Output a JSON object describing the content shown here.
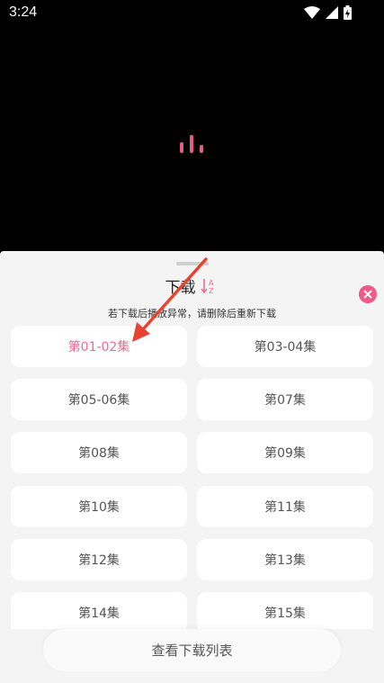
{
  "status_bar": {
    "time": "3:24",
    "icons": [
      "wifi-icon",
      "signal-icon",
      "battery-charging-icon"
    ]
  },
  "video": {
    "loading_indicator": "loading-bars-icon"
  },
  "sheet": {
    "title": "下载",
    "sort_icon": "sort-az-icon",
    "close_icon": "close-icon",
    "notice": "若下载后播放异常，请删除后重新下载",
    "episodes": [
      {
        "label": "第01-02集",
        "active": true
      },
      {
        "label": "第03-04集",
        "active": false
      },
      {
        "label": "第05-06集",
        "active": false
      },
      {
        "label": "第07集",
        "active": false
      },
      {
        "label": "第08集",
        "active": false
      },
      {
        "label": "第09集",
        "active": false
      },
      {
        "label": "第10集",
        "active": false
      },
      {
        "label": "第11集",
        "active": false
      },
      {
        "label": "第12集",
        "active": false
      },
      {
        "label": "第13集",
        "active": false
      },
      {
        "label": "第14集",
        "active": false
      },
      {
        "label": "第15集",
        "active": false
      }
    ],
    "view_list_button": "查看下载列表"
  },
  "colors": {
    "accent": "#ef6b94",
    "loader": "#e25c86",
    "annotation_arrow": "#e8432e",
    "sheet_bg": "#f4f4f4"
  }
}
